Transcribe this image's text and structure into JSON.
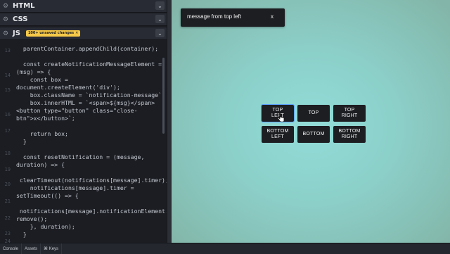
{
  "editor": {
    "html_title": "HTML",
    "css_title": "CSS",
    "js_title": "JS",
    "unsaved_badge": "100+ unsaved changes",
    "unsaved_badge_close": "✕",
    "line_numbers": [
      "13",
      "14",
      "15",
      "16",
      "17",
      "18",
      "19",
      "20",
      "21",
      "22",
      "23",
      "24"
    ],
    "code_lines": [
      "  parentContainer.appendChild(container);",
      "",
      "  const createNotificationMessageElement =",
      "(msg) => {",
      "    const box =",
      "document.createElement('div');",
      "    box.className = `notification-message`;",
      "    box.innerHTML = `<span>${msg}</span>",
      "<button type=\"button\" class=\"close-",
      "btn\">x</button>`;",
      "",
      "    return box;",
      "  }",
      "",
      "  const resetNotification = (message,",
      "duration) => {",
      "",
      " clearTimeout(notifications[message].timer);",
      "    notifications[message].timer =",
      "setTimeout(() => {",
      "",
      " notifications[message].notificationElement.",
      "remove();",
      "    }, duration);",
      "  }"
    ]
  },
  "preview": {
    "toast": {
      "message": "message from top left",
      "close": "x"
    },
    "buttons": {
      "top_left": "TOP\nLEFT",
      "top": "TOP",
      "top_right": "TOP\nRIGHT",
      "bottom_left": "BOTTOM\nLEFT",
      "bottom": "BOTTOM",
      "bottom_right": "BOTTOM\nRIGHT"
    }
  },
  "footer": {
    "console": "Console",
    "assets": "Assets",
    "keys": "⌘ Keys"
  },
  "colors": {
    "badge": "#f7c948",
    "focus_ring": "#5aa3ff",
    "button_bg": "#1d1e22",
    "preview_bg": "#8ccfc9"
  }
}
